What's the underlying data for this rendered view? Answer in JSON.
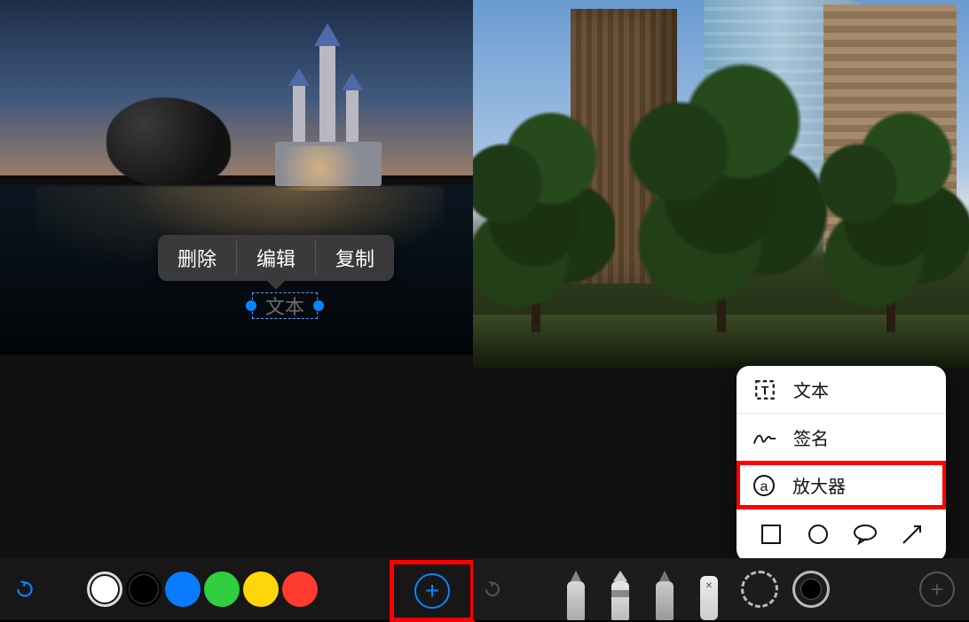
{
  "left": {
    "context_menu": {
      "delete": "删除",
      "edit": "编辑",
      "copy": "复制"
    },
    "text_element": "文本",
    "colors": [
      {
        "name": "white",
        "hex": "#ffffff",
        "selected": true
      },
      {
        "name": "black",
        "hex": "#000000",
        "selected": false
      },
      {
        "name": "blue",
        "hex": "#0a7aff",
        "selected": false
      },
      {
        "name": "green",
        "hex": "#2fcf3f",
        "selected": false
      },
      {
        "name": "yellow",
        "hex": "#ffd60a",
        "selected": false
      },
      {
        "name": "red",
        "hex": "#ff3b30",
        "selected": false
      }
    ],
    "accent": "#0a84ff",
    "highlight_border": "#ff0000"
  },
  "right": {
    "menu": {
      "text": "文本",
      "signature": "签名",
      "magnifier": "放大器",
      "shapes": [
        "rectangle",
        "circle",
        "speech-bubble",
        "arrow"
      ]
    },
    "tools": [
      "pen",
      "marker",
      "pencil",
      "eraser",
      "lasso",
      "color",
      "add"
    ]
  }
}
